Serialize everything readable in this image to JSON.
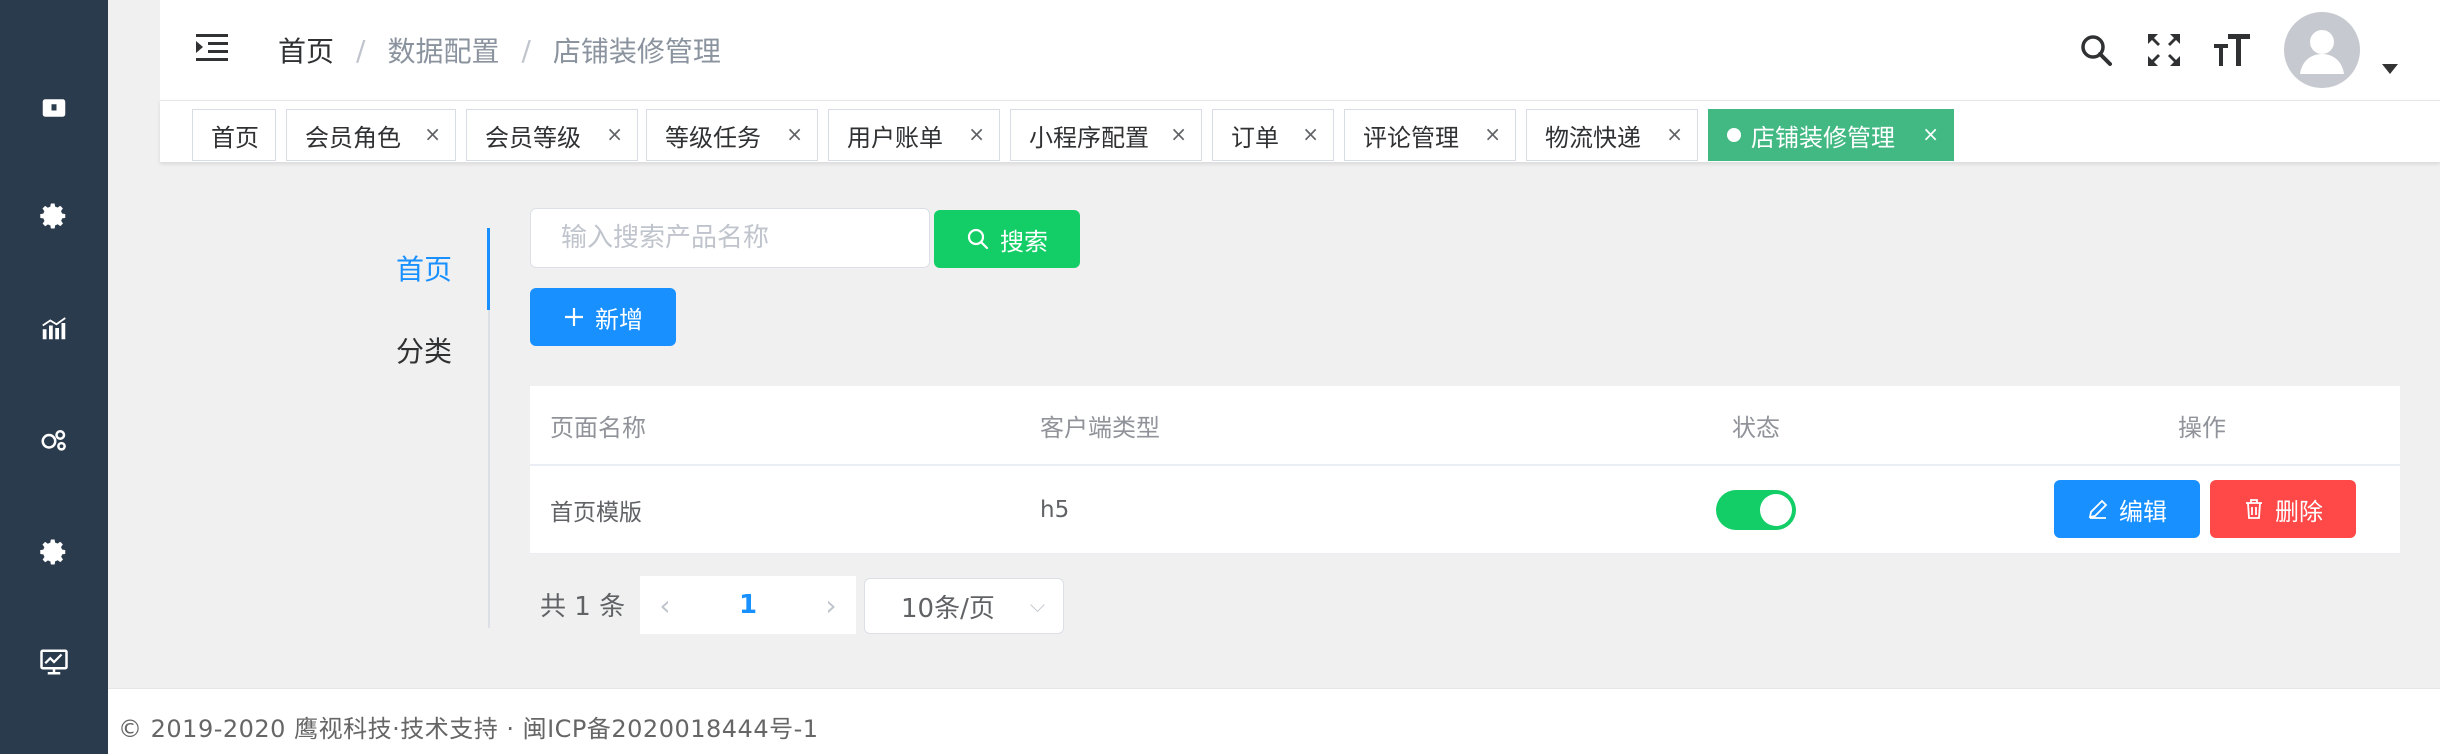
{
  "sidebar": {
    "icons": [
      "dashboard-icon",
      "settings-gear-icon",
      "chart-icon",
      "member-icon",
      "config-gear-icon",
      "monitor-icon"
    ]
  },
  "header": {
    "breadcrumb": [
      "首页",
      "数据配置",
      "店铺装修管理"
    ]
  },
  "tags": [
    {
      "label": "首页",
      "closable": false
    },
    {
      "label": "会员角色",
      "closable": true
    },
    {
      "label": "会员等级",
      "closable": true
    },
    {
      "label": "等级任务",
      "closable": true
    },
    {
      "label": "用户账单",
      "closable": true
    },
    {
      "label": "小程序配置",
      "closable": true
    },
    {
      "label": "订单",
      "closable": true
    },
    {
      "label": "评论管理",
      "closable": true
    },
    {
      "label": "物流快递",
      "closable": true
    },
    {
      "label": "店铺装修管理",
      "closable": true,
      "active": true
    }
  ],
  "tag_close_glyph": "×",
  "colors": {
    "sidebar_bg": "#2b3b4e",
    "active_tag": "#42b983",
    "primary": "#1890ff",
    "success": "#13ce66",
    "danger": "#ff4949"
  },
  "vtabs": {
    "home": "首页",
    "category": "分类"
  },
  "search": {
    "placeholder": "输入搜索产品名称",
    "value": "",
    "button_label": "搜索"
  },
  "add_button_label": "新增",
  "table": {
    "headers": {
      "name": "页面名称",
      "client": "客户端类型",
      "status": "状态",
      "actions": "操作"
    },
    "rows": [
      {
        "name": "首页模版",
        "client": "h5",
        "status_on": true
      }
    ],
    "edit_label": "编辑",
    "delete_label": "删除"
  },
  "pagination": {
    "total_text": "共 1 条",
    "current_page": "1",
    "page_size": "10条/页"
  },
  "footer": {
    "text": "© 2019-2020 鹰视科技·技术支持 · 闽ICP备2020018444号-1"
  }
}
